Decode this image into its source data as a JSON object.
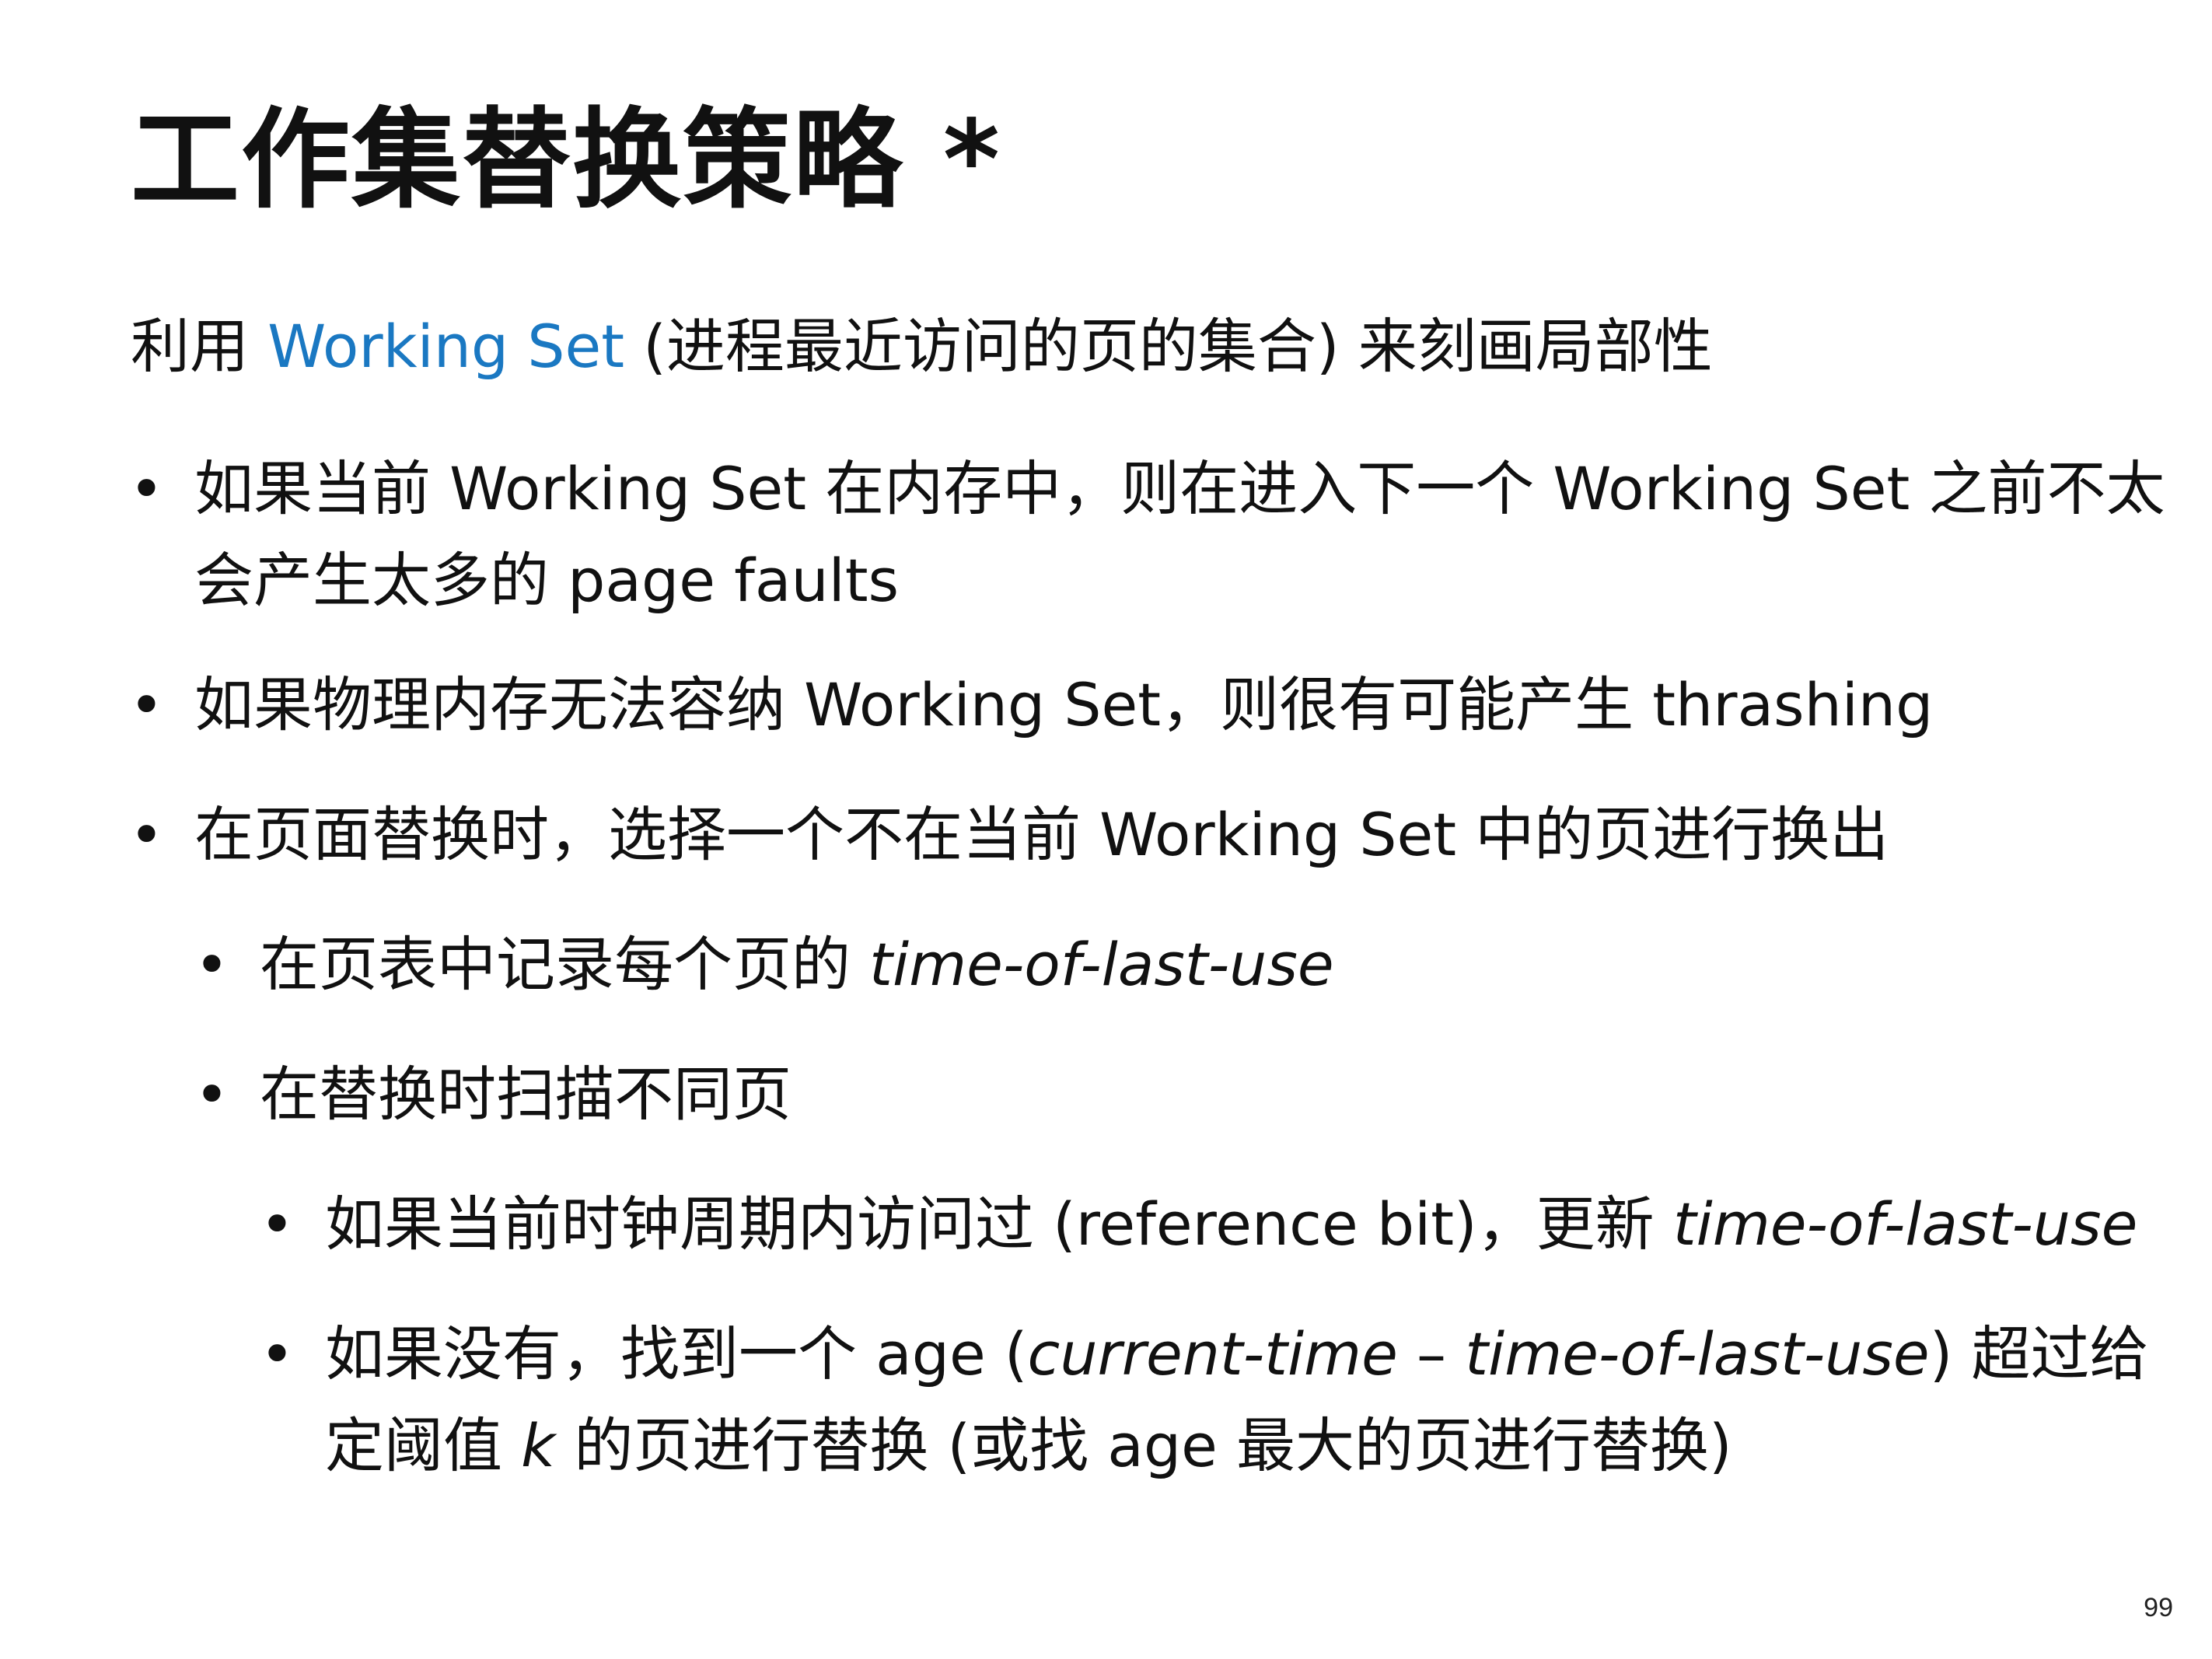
{
  "title": "工作集替换策略 *",
  "intro": {
    "before": "利用 ",
    "accent": "Working Set",
    "after": " (进程最近访问的页的集合) 来刻画局部性",
    "accent_color": "#1a78c2"
  },
  "bullet_glyph": "•",
  "items": [
    {
      "text": "如果当前 Working Set 在内存中，则在进入下一个 Working Set 之前不太会产生太多的 page faults"
    },
    {
      "text": "如果物理内存无法容纳 Working Set，则很有可能产生 thrashing"
    },
    {
      "text": "在页面替换时，选择一个不在当前 Working Set 中的页进行换出"
    },
    {
      "before": "在页表中记录每个页的 ",
      "em": "time-of-last-use"
    },
    {
      "text": "在替换时扫描不同页"
    },
    {
      "before": "如果当前时钟周期内访问过 (reference bit)，更新 ",
      "em": "time-of-last-use"
    },
    {
      "p1": "如果没有，找到一个 age (",
      "e1": "current-time",
      "p2": " – ",
      "e2": "time-of-last-use",
      "p3": ") 超过给定阈值 ",
      "e3": "k",
      "p4": " 的页进行替换 (或找 age 最大的页进行替换)"
    }
  ],
  "page_number": "99"
}
